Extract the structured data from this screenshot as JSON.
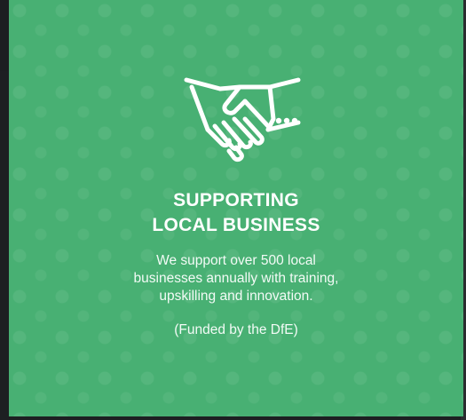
{
  "card": {
    "icon": "handshake-icon",
    "title_lines": [
      "SUPPORTING",
      "LOCAL BUSINESS"
    ],
    "body_lines": [
      "We support over 500 local",
      "businesses annually with training,",
      "upskilling and innovation."
    ],
    "funding_note": "(Funded by the DfE)"
  },
  "colors": {
    "card_background": "#48b073",
    "text": "#ffffff",
    "page_background": "#1d1f22"
  }
}
